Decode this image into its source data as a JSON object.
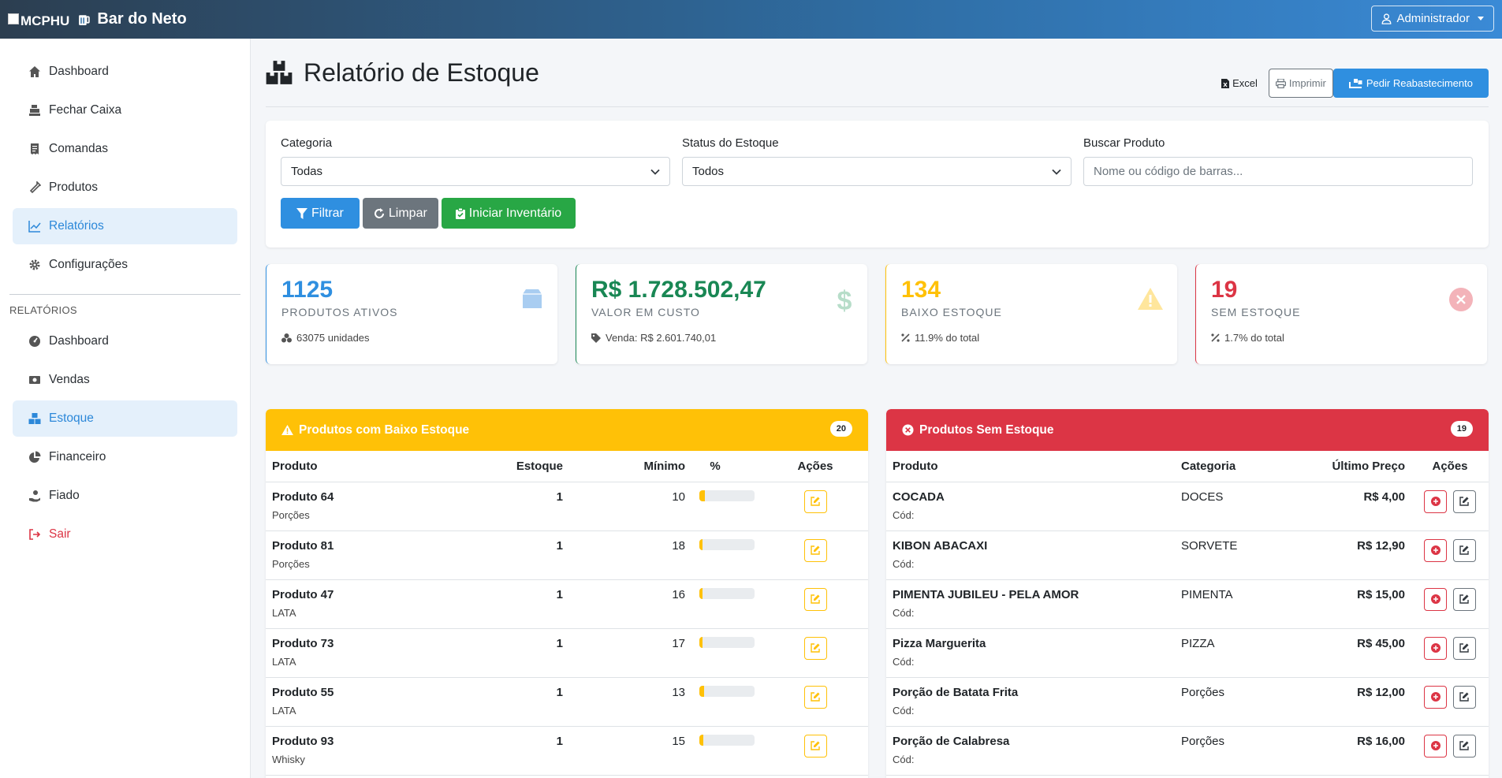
{
  "navbar": {
    "logo_alt": "MCPHU",
    "brand": "Bar do Neto",
    "user_menu": "Administrador"
  },
  "sidebar": {
    "items": [
      {
        "label": "Dashboard",
        "icon": "home-icon"
      },
      {
        "label": "Fechar Caixa",
        "icon": "cash-register-icon"
      },
      {
        "label": "Comandas",
        "icon": "receipt-icon"
      },
      {
        "label": "Produtos",
        "icon": "bottle-icon"
      },
      {
        "label": "Relatórios",
        "icon": "chart-line-icon",
        "active": true
      },
      {
        "label": "Configurações",
        "icon": "gear-icon"
      }
    ],
    "reports_heading": "RELATÓRIOS",
    "report_items": [
      {
        "label": "Dashboard",
        "icon": "gauge-icon"
      },
      {
        "label": "Vendas",
        "icon": "money-icon"
      },
      {
        "label": "Estoque",
        "icon": "boxes-icon",
        "active": true
      },
      {
        "label": "Financeiro",
        "icon": "pie-chart-icon"
      },
      {
        "label": "Fiado",
        "icon": "hand-holding-icon"
      },
      {
        "label": "Sair",
        "icon": "logout-icon",
        "danger": true
      }
    ]
  },
  "page": {
    "title": "Relatório de Estoque",
    "actions": {
      "excel": "Excel",
      "print": "Imprimir",
      "restock": "Pedir Reabastecimento"
    }
  },
  "filters": {
    "category_label": "Categoria",
    "category_value": "Todas",
    "status_label": "Status do Estoque",
    "status_value": "Todos",
    "search_label": "Buscar Produto",
    "search_placeholder": "Nome ou código de barras...",
    "filter_btn": "Filtrar",
    "clear_btn": "Limpar",
    "inventory_btn": "Iniciar Inventário"
  },
  "stats": [
    {
      "value": "1125",
      "label": "Produtos Ativos",
      "sub": "63075 unidades",
      "color": "#2f8fe0"
    },
    {
      "value": "R$ 1.728.502,47",
      "label": "Valor em Custo",
      "sub": "Venda: R$ 2.601.740,01",
      "color": "#198754"
    },
    {
      "value": "134",
      "label": "Baixo Estoque",
      "sub": "11.9% do total",
      "color": "#ffc107"
    },
    {
      "value": "19",
      "label": "Sem Estoque",
      "sub": "1.7% do total",
      "color": "#dc3545"
    }
  ],
  "low_stock": {
    "title": "Produtos com Baixo Estoque",
    "count": "20",
    "headers": {
      "product": "Produto",
      "stock": "Estoque",
      "min": "Mínimo",
      "pct": "%",
      "actions": "Ações"
    },
    "rows": [
      {
        "name": "Produto 64",
        "cat": "Porções",
        "stock": "1",
        "min": "10",
        "pct": 0.1
      },
      {
        "name": "Produto 81",
        "cat": "Porções",
        "stock": "1",
        "min": "18",
        "pct": 0.06
      },
      {
        "name": "Produto 47",
        "cat": "LATA",
        "stock": "1",
        "min": "16",
        "pct": 0.06
      },
      {
        "name": "Produto 73",
        "cat": "LATA",
        "stock": "1",
        "min": "17",
        "pct": 0.06
      },
      {
        "name": "Produto 55",
        "cat": "LATA",
        "stock": "1",
        "min": "13",
        "pct": 0.08
      },
      {
        "name": "Produto 93",
        "cat": "Whisky",
        "stock": "1",
        "min": "15",
        "pct": 0.07
      }
    ]
  },
  "no_stock": {
    "title": "Produtos Sem Estoque",
    "count": "19",
    "headers": {
      "product": "Produto",
      "category": "Categoria",
      "last_price": "Último Preço",
      "actions": "Ações"
    },
    "rows": [
      {
        "name": "COCADA",
        "code": "Cód:",
        "cat": "DOCES",
        "price": "R$ 4,00"
      },
      {
        "name": "KIBON ABACAXI",
        "code": "Cód:",
        "cat": "SORVETE",
        "price": "R$ 12,90"
      },
      {
        "name": "PIMENTA JUBILEU - PELA AMOR",
        "code": "Cód:",
        "cat": "PIMENTA",
        "price": "R$ 15,00"
      },
      {
        "name": "Pizza Marguerita",
        "code": "Cód:",
        "cat": "PIZZA",
        "price": "R$ 45,00"
      },
      {
        "name": "Porção de Batata Frita",
        "code": "Cód:",
        "cat": "Porções",
        "price": "R$ 12,00"
      },
      {
        "name": "Porção de Calabresa",
        "code": "Cód:",
        "cat": "Porções",
        "price": "R$ 16,00"
      }
    ]
  }
}
